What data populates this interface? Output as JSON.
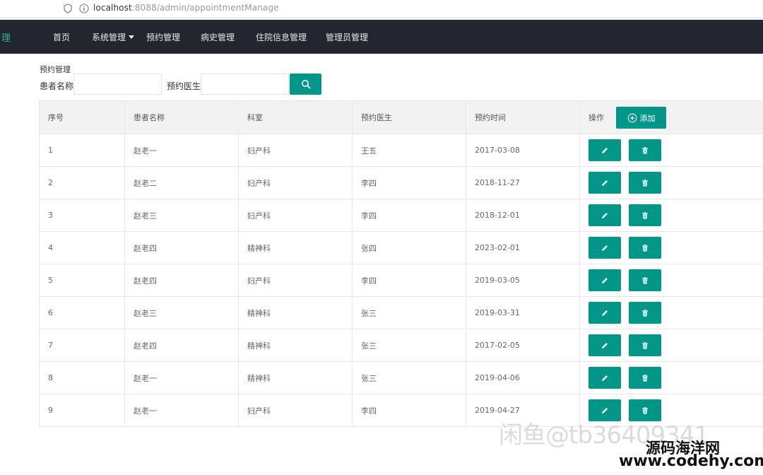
{
  "browser": {
    "url_host": "localhost",
    "url_rest": ":8088/admin/appointmentManage"
  },
  "nav": {
    "brand": "理",
    "items": [
      {
        "label": "首页"
      },
      {
        "label": "系统管理"
      },
      {
        "label": "预约管理"
      },
      {
        "label": "病史管理"
      },
      {
        "label": "住院信息管理"
      },
      {
        "label": "管理员管理"
      }
    ]
  },
  "page": {
    "title": "预约管理",
    "filters": {
      "patient_label": "患者名称",
      "patient_value": "",
      "doctor_label": "预约医生",
      "doctor_value": ""
    }
  },
  "table": {
    "headers": [
      "序号",
      "患者名称",
      "科室",
      "预约医生",
      "预约时间",
      "操作"
    ],
    "add_label": "添加",
    "rows": [
      [
        "1",
        "赵老一",
        "妇产科",
        "王五",
        "2017-03-08"
      ],
      [
        "2",
        "赵老二",
        "妇产科",
        "李四",
        "2018-11-27"
      ],
      [
        "3",
        "赵老三",
        "妇产科",
        "李四",
        "2018-12-01"
      ],
      [
        "4",
        "赵老四",
        "精神科",
        "张四",
        "2023-02-01"
      ],
      [
        "5",
        "赵老四",
        "妇产科",
        "李四",
        "2019-03-05"
      ],
      [
        "6",
        "赵老三",
        "精神科",
        "张三",
        "2019-03-31"
      ],
      [
        "7",
        "赵老四",
        "精神科",
        "张三",
        "2017-02-05"
      ],
      [
        "8",
        "赵老一",
        "精神科",
        "张三",
        "2019-04-06"
      ],
      [
        "9",
        "赵老一",
        "妇产科",
        "李四",
        "2019-04-27"
      ]
    ]
  },
  "watermark": {
    "line1": "闲鱼@tb36409341",
    "line2": "源码海洋网",
    "line3": "www.codehy.com"
  },
  "colors": {
    "accent": "#009688",
    "nav_bg": "#23262e"
  }
}
